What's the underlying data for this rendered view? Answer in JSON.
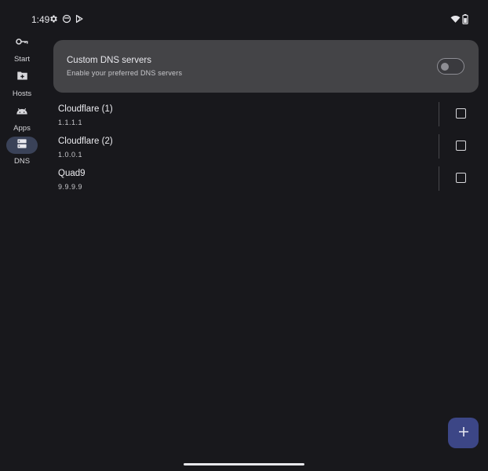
{
  "status_bar": {
    "time": "1:49",
    "icons_left": [
      "gear-icon",
      "face-icon",
      "play-store-icon"
    ],
    "icons_right": [
      "wifi-icon",
      "battery-icon"
    ]
  },
  "nav_rail": {
    "items": [
      {
        "label": "Start",
        "icon": "key-icon",
        "active": false
      },
      {
        "label": "Hosts",
        "icon": "folder-add-icon",
        "active": false
      },
      {
        "label": "Apps",
        "icon": "android-icon",
        "active": false
      },
      {
        "label": "DNS",
        "icon": "dns-icon",
        "active": true
      }
    ]
  },
  "custom_dns": {
    "title": "Custom DNS servers",
    "subtitle": "Enable your preferred DNS servers",
    "enabled": false
  },
  "servers": [
    {
      "name": "Cloudflare (1)",
      "ip": "1.1.1.1",
      "checked": false
    },
    {
      "name": "Cloudflare (2)",
      "ip": "1.0.0.1",
      "checked": false
    },
    {
      "name": "Quad9",
      "ip": "9.9.9.9",
      "checked": false
    }
  ],
  "fab": {
    "icon": "plus-icon"
  },
  "colors": {
    "background": "#18181c",
    "card": "#444447",
    "rail_active": "#3a4258",
    "fab": "#3c4686"
  }
}
